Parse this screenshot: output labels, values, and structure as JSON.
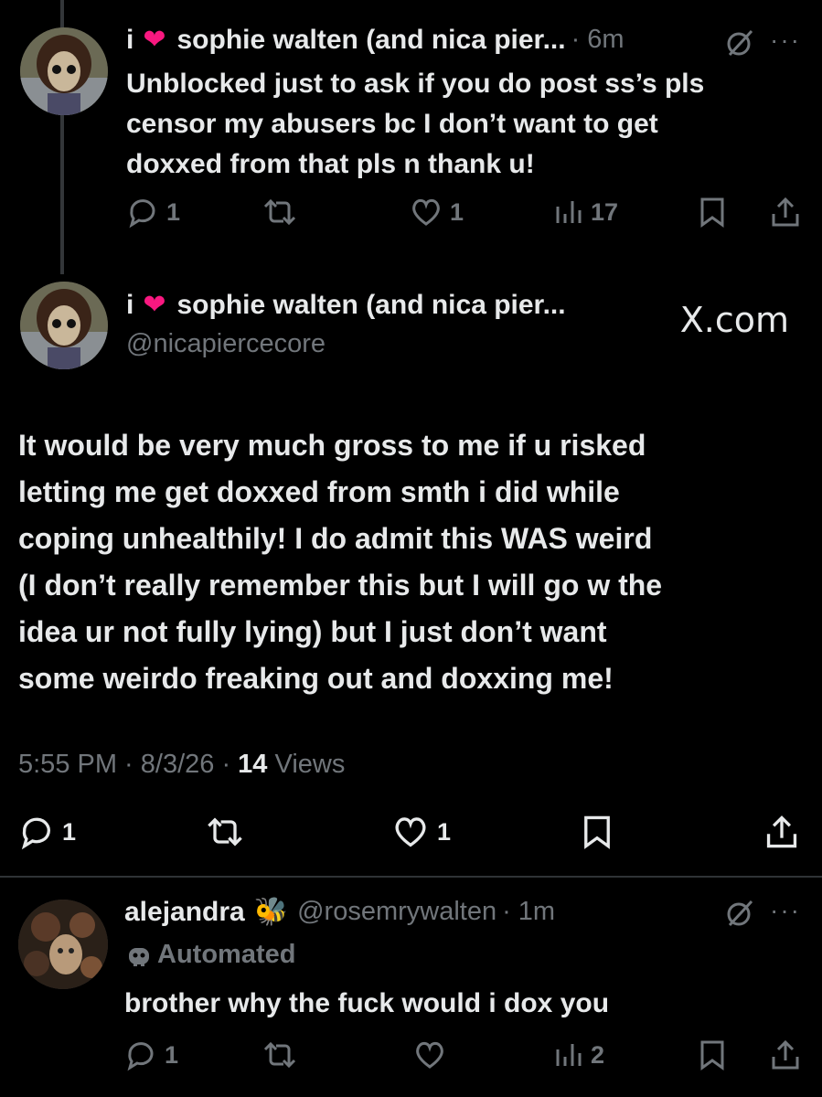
{
  "reply1": {
    "prefix": "i",
    "display_name": "sophie walten (and nica pier...",
    "time": "· 6m",
    "text_lines": [
      "Unblocked just to ask if you do post ss’s pls",
      "censor my abusers bc I don’t want to get",
      "doxxed from that pls n thank u!"
    ],
    "replies": "1",
    "reposts": "",
    "likes": "1",
    "views": "17"
  },
  "main": {
    "prefix": "i",
    "display_name": "sophie walten (and nica pier...",
    "handle": "@nicapiercecore",
    "watermark": "X.com",
    "text_lines": [
      "It would be very much gross to me if u risked",
      "letting me get doxxed from smth i did while",
      "coping unhealthily! I do admit this WAS weird",
      "(I don’t really remember this but I will go w the",
      "idea ur not fully lying) but I just don’t want",
      "some weirdo freaking out and doxxing me!"
    ],
    "timestamp": "5:55 PM · 8/3/26 · ",
    "views_count": "14",
    "views_label": " Views",
    "replies": "1",
    "likes": "1"
  },
  "reply2": {
    "display_name": "alejandra",
    "emoji": "🐝",
    "handle": "@rosemrywalten",
    "time": "· 1m",
    "automated_label": "Automated",
    "text": "brother why the fuck would i dox you",
    "replies": "1",
    "views": "2"
  },
  "colors": {
    "accent_heart": "#f91880",
    "muted": "#71767b",
    "text": "#e7e9ea",
    "background": "#000000"
  }
}
